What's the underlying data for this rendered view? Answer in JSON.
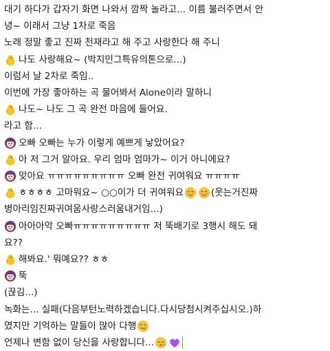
{
  "lines": [
    {
      "text": "대기 하다가 갑자기 화면 나와서 깜짝 놀라고... 이름 불러주면서 안"
    },
    {
      "text": "녕~ 이래서 그냥 1차로 죽음"
    },
    {
      "text": "노래 정말 좋고 진짜 천재라고 해 주고 사랑한다 해 주니"
    },
    {
      "icon": "chick-icon",
      "text": "나도 사랑해요~ (박지민그특유의톤으로...)"
    },
    {
      "text": "이럼서 날 2차로 죽임.."
    },
    {
      "text": "이번에 가장 좋아하는 곡 물어봐서 Alone이라 말하니"
    },
    {
      "icon": "chick-icon",
      "text": "나도~ 나도 그 곡 완전 마음에 들어요."
    },
    {
      "text": "라고 함..."
    },
    {
      "icon": "purple-face-icon",
      "text": "오빠 오빠는 누가 이렇게 예쁘게 낳았어요?"
    },
    {
      "icon": "chick-icon",
      "text": "아 저 그거 알아요. 우리 엄마 엄마가~ 이거 아니에요?"
    },
    {
      "icon": "purple-face-icon",
      "text": "맞아요 ㅠㅠㅠㅠㅠㅠㅠㅠㅠ 오빠 완전 귀여워요 ㅠㅠㅠㅠ"
    },
    {
      "icon": "chick-icon",
      "text": "ㅎㅎㅎㅎ 고마워요~ ○○이가 더 귀여워요",
      "suffix": "(웃는거진짜"
    },
    {
      "text": "병아리임진짜귀여움사랑스러움내거임...)"
    },
    {
      "icon": "purple-face-icon",
      "text": "아아아악 오빠ㅠㅠㅠㅠㅠㅠㅠㅠㅠ 저 뚝배기로 3행시 해도 돼"
    },
    {
      "text": "요??"
    },
    {
      "icon": "chick-icon",
      "text": "해봐요.' 뭐예요?? ㅎㅎ"
    },
    {
      "icon": "purple-face-icon",
      "text": "뚝"
    },
    {
      "text": "(끊김...)"
    },
    {
      "text": "녹화는... 실패(다음부턴노력하겠습니다.다시당첨시켜주십시오.)하"
    },
    {
      "text": "였지만 기억하는 말들이 많아 다행"
    },
    {
      "text": "언제나 변함 없이 당신을 사랑합니다..."
    }
  ],
  "icons": {
    "chick": "chick-icon",
    "purple_face": "purple-face-icon",
    "blush_smile": "blush-smile-emoji",
    "woozy": "woozy-face-emoji",
    "crying": "crying-face-emoji",
    "heart": "purple-heart-emoji"
  },
  "colors": {
    "chick_yellow": "#f6c61b",
    "purple_face": "#6b3a8a",
    "heart_purple": "#b04bf0",
    "emoji_yellow": "#f7c43a"
  }
}
